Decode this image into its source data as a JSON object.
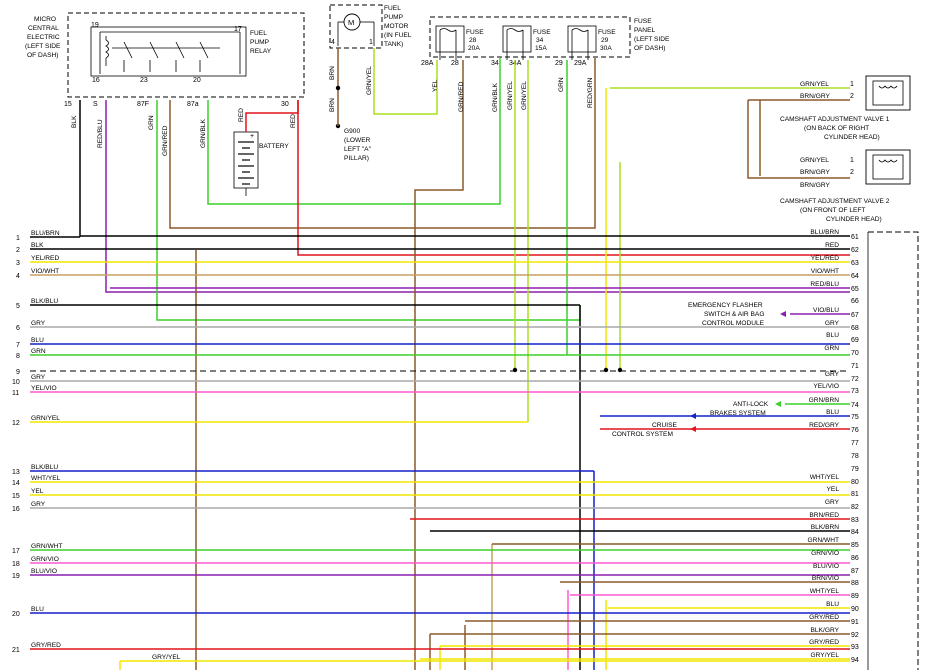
{
  "components": {
    "relay": [
      "MICRO",
      "CENTRAL",
      "ELECTRIC",
      "(LEFT SIDE",
      "OF DASH)"
    ],
    "relay_name": [
      "FUEL",
      "PUMP",
      "RELAY"
    ],
    "relay_pins": [
      "19",
      "17",
      "16",
      "23",
      "20"
    ],
    "relay_bottom_pins": [
      "15",
      "S",
      "87F",
      "87a",
      "30"
    ],
    "pump": [
      "FUEL",
      "PUMP",
      "MOTOR",
      "(IN FUEL",
      "TANK)"
    ],
    "pump_pins": [
      "4",
      "1"
    ],
    "pump_symbol": "M",
    "ground": [
      "G900",
      "(LOWER",
      "LEFT \"A\"",
      "PILLAR)"
    ],
    "battery": "BATTERY",
    "fuse_panel": [
      "FUSE",
      "PANEL",
      "(LEFT SIDE",
      "OF DASH)"
    ],
    "fuses": [
      {
        "name": "FUSE",
        "num": "28",
        "amp": "20A"
      },
      {
        "name": "FUSE",
        "num": "34",
        "amp": "15A"
      },
      {
        "name": "FUSE",
        "num": "29",
        "amp": "30A"
      }
    ],
    "fuse_pins": [
      "28A",
      "28",
      "34",
      "34A",
      "29",
      "29A"
    ],
    "valve1": [
      "CAMSHAFT ADJUSTMENT VALVE 1",
      "(ON BACK OF RIGHT",
      "CYLINDER HEAD)"
    ],
    "valve2": [
      "CAMSHAFT ADJUSTMENT VALVE 2",
      "(ON FRONT OF LEFT",
      "CYLINDER HEAD)"
    ],
    "valve1_wires": [
      "GRN/YEL",
      "BRN/GRY"
    ],
    "valve2_wires": [
      "GRN/YEL",
      "BRN/GRY",
      "BRN/GRY"
    ],
    "valve_pins": [
      "1",
      "2"
    ],
    "emergency": [
      "EMERGENCY FLASHER",
      "SWITCH & AIR BAG",
      "CONTROL MODULE"
    ],
    "abs": [
      "ANTI-LOCK",
      "BRAKES SYSTEM"
    ],
    "cruise": [
      "CRUISE",
      "CONTROL SYSTEM"
    ]
  },
  "vertical_wires": [
    "BLK",
    "RED/BLU",
    "GRN",
    "GRN/RED",
    "GRN/BLK",
    "RED",
    "RED",
    "BRN",
    "GRN/YEL",
    "BRN",
    "YEL",
    "GRN/RED",
    "GRN/BLK",
    "GRN/YEL",
    "GRN/YEL",
    "GRN",
    "RED/GRN"
  ],
  "left_rows": [
    {
      "pin": "1",
      "label": "BLU/BRN"
    },
    {
      "pin": "2",
      "label": "BLK"
    },
    {
      "pin": "3",
      "label": "YEL/RED"
    },
    {
      "pin": "4",
      "label": "VIO/WHT"
    },
    {
      "pin": "5",
      "label": "BLK/BLU"
    },
    {
      "pin": "6",
      "label": "GRY"
    },
    {
      "pin": "7",
      "label": "BLU"
    },
    {
      "pin": "8",
      "label": "GRN"
    },
    {
      "pin": "9",
      "label": ""
    },
    {
      "pin": "10",
      "label": "GRY"
    },
    {
      "pin": "11",
      "label": "YEL/VIO"
    },
    {
      "pin": "12",
      "label": "GRN/YEL"
    },
    {
      "pin": "13",
      "label": "BLK/BLU"
    },
    {
      "pin": "14",
      "label": "WHT/YEL"
    },
    {
      "pin": "15",
      "label": "YEL"
    },
    {
      "pin": "16",
      "label": "GRY"
    },
    {
      "pin": "17",
      "label": "GRN/WHT"
    },
    {
      "pin": "18",
      "label": "GRN/VIO"
    },
    {
      "pin": "19",
      "label": "BLU/VIO"
    },
    {
      "pin": "20",
      "label": "BLU"
    },
    {
      "pin": "21",
      "label": "GRY/RED"
    },
    {
      "pin": "",
      "label": "GRY/YEL"
    }
  ],
  "right_rows": [
    {
      "pin": "61",
      "label": "BLU/BRN"
    },
    {
      "pin": "62",
      "label": "RED"
    },
    {
      "pin": "63",
      "label": "YEL/RED"
    },
    {
      "pin": "64",
      "label": "VIO/WHT"
    },
    {
      "pin": "65",
      "label": "RED/BLU"
    },
    {
      "pin": "66",
      "label": ""
    },
    {
      "pin": "67",
      "label": "VIO/BLU"
    },
    {
      "pin": "68",
      "label": "GRY"
    },
    {
      "pin": "69",
      "label": "BLU"
    },
    {
      "pin": "70",
      "label": "GRN"
    },
    {
      "pin": "71",
      "label": ""
    },
    {
      "pin": "72",
      "label": "GRY"
    },
    {
      "pin": "73",
      "label": "YEL/VIO"
    },
    {
      "pin": "74",
      "label": "GRN/BRN"
    },
    {
      "pin": "75",
      "label": "BLU"
    },
    {
      "pin": "76",
      "label": "RED/GRY"
    },
    {
      "pin": "77",
      "label": ""
    },
    {
      "pin": "78",
      "label": ""
    },
    {
      "pin": "79",
      "label": ""
    },
    {
      "pin": "80",
      "label": "WHT/YEL"
    },
    {
      "pin": "81",
      "label": "YEL"
    },
    {
      "pin": "82",
      "label": "GRY"
    },
    {
      "pin": "83",
      "label": "BRN/RED"
    },
    {
      "pin": "84",
      "label": "BLK/BRN"
    },
    {
      "pin": "85",
      "label": "GRN/WHT"
    },
    {
      "pin": "86",
      "label": "GRN/VIO"
    },
    {
      "pin": "87",
      "label": "BLU/VIO"
    },
    {
      "pin": "88",
      "label": "BRN/VIO"
    },
    {
      "pin": "89",
      "label": "WHT/YEL"
    },
    {
      "pin": "90",
      "label": "BLU"
    },
    {
      "pin": "91",
      "label": "GRY/RED"
    },
    {
      "pin": "92",
      "label": "BLK/GRY"
    },
    {
      "pin": "93",
      "label": "GRY/RED"
    },
    {
      "pin": "94",
      "label": "GRY/YEL"
    }
  ],
  "colors": {
    "BLK": "#000000",
    "BRN": "#8b5a2b",
    "RED": "#e0141c",
    "YEL": "#f2e600",
    "GRN": "#3ad12a",
    "LGRN": "#a8e01e",
    "BLU": "#1420c8",
    "VIO": "#8a1fb0",
    "GRY": "#a9a9a9",
    "PINK": "#ff5ad0",
    "TAN": "#c8a060"
  }
}
